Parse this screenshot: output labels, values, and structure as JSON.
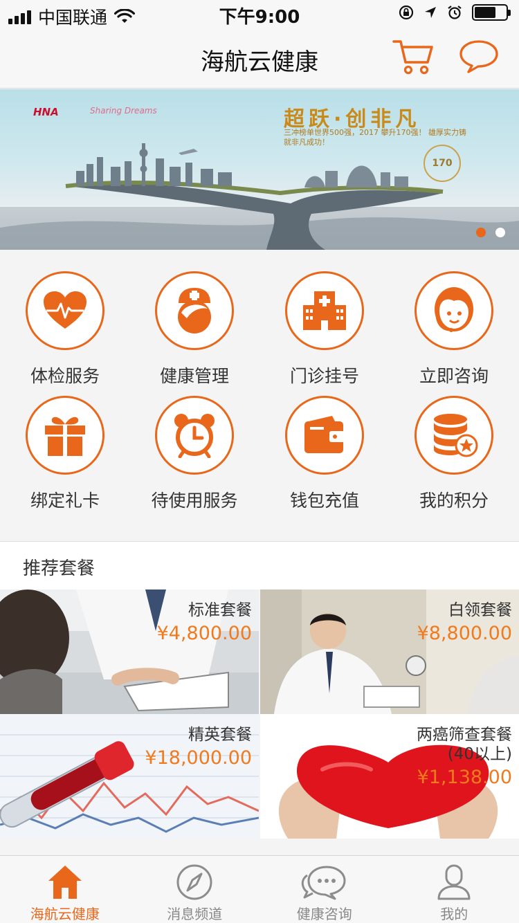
{
  "status_bar": {
    "carrier": "中国联通",
    "time": "下午9:00",
    "battery_level": 0.68
  },
  "nav": {
    "title": "海航云健康",
    "cart_icon": "cart-icon",
    "message_icon": "message-icon"
  },
  "banner": {
    "brand": "HNA",
    "slogan": "Sharing Dreams",
    "headline": "超跃·创非凡",
    "subtext": "三冲榜单世界500强，2017 攀升170强！ 雄厚实力铸就非凡成功！",
    "rank": "170",
    "slides": 2,
    "active_slide": 1
  },
  "services": [
    {
      "label": "体检服务",
      "icon": "heart-pulse-icon"
    },
    {
      "label": "健康管理",
      "icon": "nurse-icon"
    },
    {
      "label": "门诊挂号",
      "icon": "hospital-icon"
    },
    {
      "label": "立即咨询",
      "icon": "headset-agent-icon"
    },
    {
      "label": "绑定礼卡",
      "icon": "gift-icon"
    },
    {
      "label": "待使用服务",
      "icon": "alarm-clock-icon"
    },
    {
      "label": "钱包充值",
      "icon": "wallet-icon"
    },
    {
      "label": "我的积分",
      "icon": "coins-star-icon"
    }
  ],
  "recommend": {
    "title": "推荐套餐",
    "packages": [
      {
        "name": "标准套餐",
        "price": "¥4,800.00"
      },
      {
        "name": "白领套餐",
        "price": "¥8,800.00"
      },
      {
        "name": "精英套餐",
        "price": "¥18,000.00"
      },
      {
        "name": "两癌筛查套餐",
        "name_line2": "(40以上)",
        "price": "¥1,138.00"
      }
    ]
  },
  "tabbar": {
    "tabs": [
      {
        "label": "海航云健康",
        "icon": "home-icon",
        "active": true
      },
      {
        "label": "消息频道",
        "icon": "compass-icon",
        "active": false
      },
      {
        "label": "健康咨询",
        "icon": "chat-bubbles-icon",
        "active": false
      },
      {
        "label": "我的",
        "icon": "user-icon",
        "active": false
      }
    ]
  },
  "colors": {
    "accent": "#e8671a",
    "price": "#f07a1e"
  }
}
